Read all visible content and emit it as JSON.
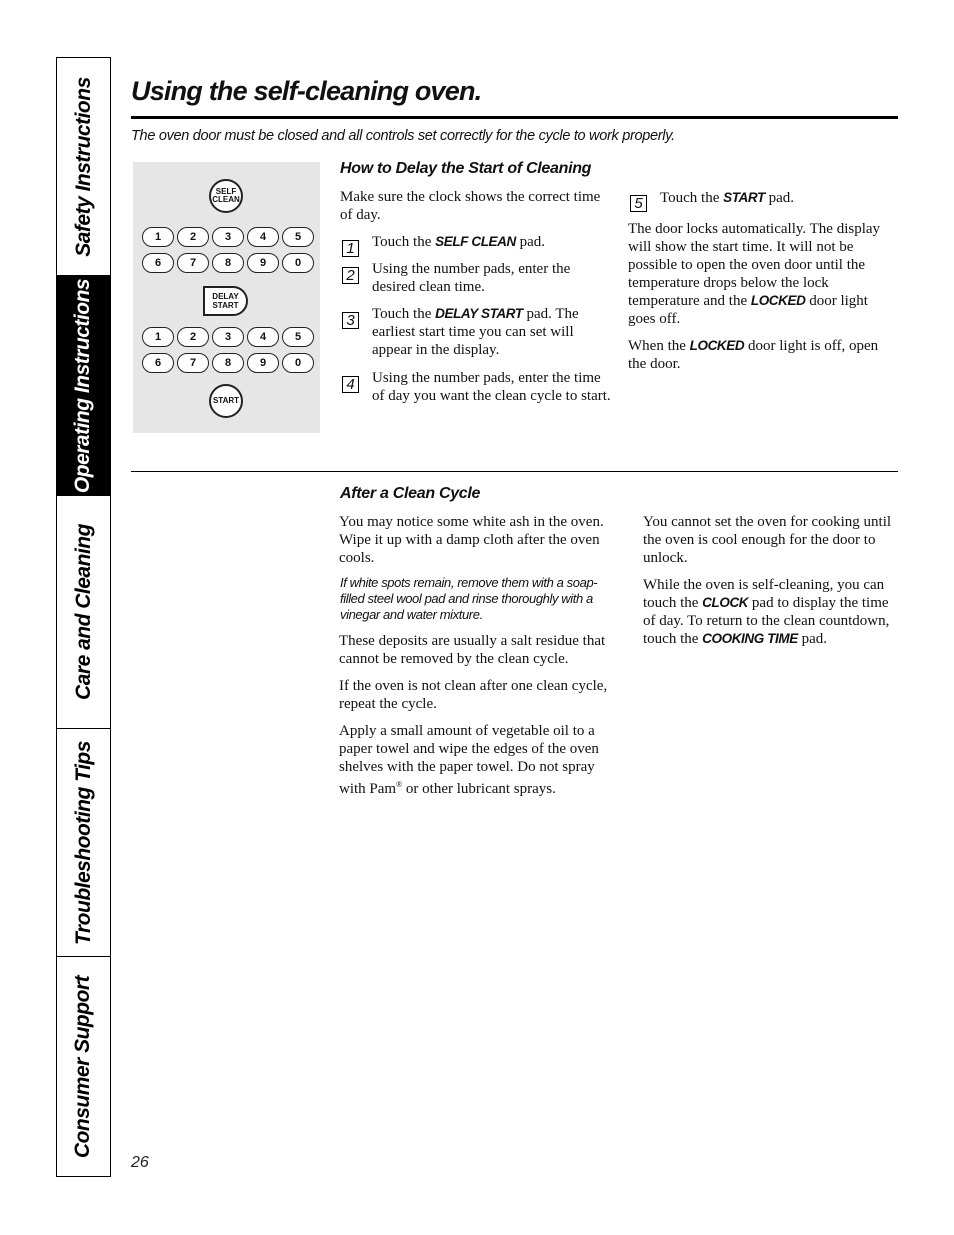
{
  "side_tabs": [
    {
      "label": "Safety Instructions",
      "active": false
    },
    {
      "label": "Operating Instructions",
      "active": true
    },
    {
      "label": "Care and Cleaning",
      "active": false
    },
    {
      "label": "Troubleshooting Tips",
      "active": false
    },
    {
      "label": "Consumer Support",
      "active": false
    }
  ],
  "page": {
    "title": "Using the self-cleaning oven.",
    "subtitle": "The oven door must be closed and all controls set correctly for the cycle to work properly.",
    "page_number": "26"
  },
  "keypad": {
    "self_clean": [
      "SELF",
      "CLEAN"
    ],
    "row1": [
      "1",
      "2",
      "3",
      "4",
      "5"
    ],
    "row2": [
      "6",
      "7",
      "8",
      "9",
      "0"
    ],
    "delay_start": [
      "DELAY",
      "START"
    ],
    "start": "START"
  },
  "delay_section": {
    "heading": "How to Delay the Start of Cleaning",
    "intro": "Make sure the clock shows the correct time of day.",
    "steps": [
      {
        "num": "1",
        "pre": "Touch the ",
        "kw": "SELF CLEAN",
        "post": " pad."
      },
      {
        "num": "2",
        "pre": "Using the number pads, enter the desired clean time.",
        "kw": "",
        "post": ""
      },
      {
        "num": "3",
        "pre": "Touch the ",
        "kw": "DELAY START",
        "post": " pad. The earliest start time you can set will appear in the display."
      },
      {
        "num": "4",
        "pre": "Using the number pads, enter the time of day you want the clean cycle to start.",
        "kw": "",
        "post": ""
      },
      {
        "num": "5",
        "pre": "Touch the ",
        "kw": "START",
        "post": " pad."
      }
    ],
    "para1_pre": "The door locks automatically. The display will show the start time. It will not be possible to open the oven door until the temperature drops below the lock temperature and the ",
    "para1_kw": "LOCKED",
    "para1_post": " door light goes off.",
    "para2_pre": "When the ",
    "para2_kw": "LOCKED",
    "para2_post": " door light is off, open the door."
  },
  "after_section": {
    "heading": "After a Clean Cycle",
    "p1": "You may notice some white ash in the oven. Wipe it up with a damp cloth after the oven cools.",
    "p2_italic": "If white spots remain, remove them with a soap-filled steel wool pad and rinse thoroughly with a vinegar and water mixture.",
    "p3": "These deposits are usually a salt residue that cannot be removed by the clean cycle.",
    "p4": "If the oven is not clean after one clean cycle, repeat the cycle.",
    "p5_pre": "Apply a small amount of vegetable oil to a paper towel and wipe the edges of the oven shelves with the paper towel. Do not spray with Pam",
    "p5_reg": "®",
    "p5_post": " or other lubricant sprays.",
    "r1": "You cannot set the oven for cooking until the oven is cool enough for the door to unlock.",
    "r2_pre": "While the oven is self-cleaning, you can touch the ",
    "r2_kw1": "CLOCK",
    "r2_mid": " pad to display the time of day. To return to the clean countdown, touch the ",
    "r2_kw2": "COOKING TIME",
    "r2_post": " pad."
  }
}
